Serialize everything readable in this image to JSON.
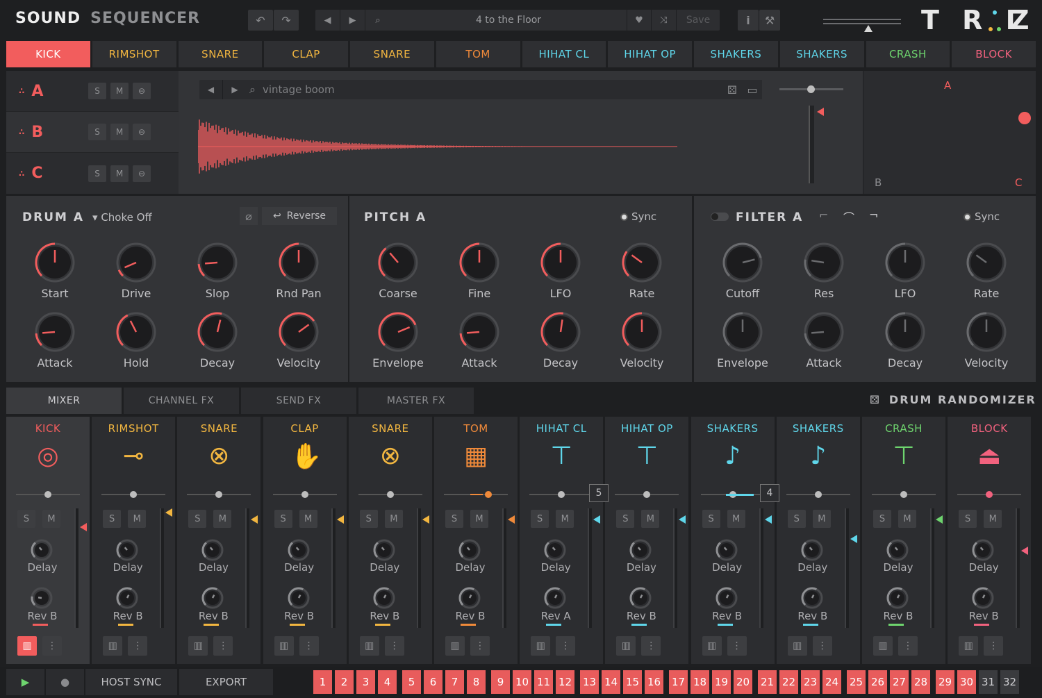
{
  "header": {
    "title_a": "SOUND",
    "title_b": "SEQUENCER",
    "preset_name": "4 to the Floor",
    "save_label": "Save",
    "logo": "TRIAZ"
  },
  "instruments": [
    {
      "label": "KICK",
      "color": "#f25d5d"
    },
    {
      "label": "RIMSHOT",
      "color": "#f2b640"
    },
    {
      "label": "SNARE",
      "color": "#f2b640"
    },
    {
      "label": "CLAP",
      "color": "#f2b640"
    },
    {
      "label": "SNARE",
      "color": "#f2b640"
    },
    {
      "label": "TOM",
      "color": "#f08a3a"
    },
    {
      "label": "HIHAT CL",
      "color": "#5fd6ea"
    },
    {
      "label": "HIHAT OP",
      "color": "#5fd6ea"
    },
    {
      "label": "SHAKERS",
      "color": "#5fd6ea"
    },
    {
      "label": "SHAKERS",
      "color": "#5fd6ea"
    },
    {
      "label": "CRASH",
      "color": "#6ed46e"
    },
    {
      "label": "BLOCK",
      "color": "#f2627e"
    }
  ],
  "layers": [
    {
      "letter": "A",
      "s": "S",
      "m": "M"
    },
    {
      "letter": "B",
      "s": "S",
      "m": "M"
    },
    {
      "letter": "C",
      "s": "S",
      "m": "M"
    }
  ],
  "sample": {
    "name": "vintage boom"
  },
  "xy": {
    "a": "A",
    "b": "B",
    "c": "C"
  },
  "drum": {
    "title": "DRUM A",
    "choke": "Choke Off",
    "reverse": "Reverse",
    "knobs": [
      {
        "label": "Start",
        "value": 0.5
      },
      {
        "label": "Drive",
        "value": 0.08
      },
      {
        "label": "Slop",
        "value": 0.15
      },
      {
        "label": "Rnd Pan",
        "value": 0.5
      },
      {
        "label": "Attack",
        "value": 0.15
      },
      {
        "label": "Hold",
        "value": 0.4
      },
      {
        "label": "Decay",
        "value": 0.55
      },
      {
        "label": "Velocity",
        "value": 0.7
      }
    ]
  },
  "pitch": {
    "title": "PITCH A",
    "sync": "Sync",
    "knobs": [
      {
        "label": "Coarse",
        "value": 0.35
      },
      {
        "label": "Fine",
        "value": 0.5
      },
      {
        "label": "LFO",
        "value": 0.5
      },
      {
        "label": "Rate",
        "value": 0.3
      },
      {
        "label": "Envelope",
        "value": 0.75
      },
      {
        "label": "Attack",
        "value": 0.15
      },
      {
        "label": "Decay",
        "value": 0.53
      },
      {
        "label": "Velocity",
        "value": 0.5
      }
    ]
  },
  "filter": {
    "title": "FILTER A",
    "sync": "Sync",
    "knobs": [
      {
        "label": "Cutoff",
        "value": 0.78
      },
      {
        "label": "Res",
        "value": 0.2
      },
      {
        "label": "LFO",
        "value": 0.5
      },
      {
        "label": "Rate",
        "value": 0.3
      },
      {
        "label": "Envelope",
        "value": 0.5
      },
      {
        "label": "Attack",
        "value": 0.15
      },
      {
        "label": "Decay",
        "value": 0.5
      },
      {
        "label": "Velocity",
        "value": 0.5
      }
    ]
  },
  "mixer_tabs": [
    "MIXER",
    "CHANNEL FX",
    "SEND FX",
    "MASTER FX"
  ],
  "randomizer": "DRUM RANDOMIZER",
  "mixer": {
    "delay_label": "Delay",
    "rev_labels": [
      "Rev B",
      "Rev B",
      "Rev B",
      "Rev B",
      "Rev B",
      "Rev B",
      "Rev A",
      "Rev B",
      "Rev B",
      "Rev B",
      "Rev B",
      "Rev B"
    ],
    "badge_hihat": "5",
    "badge_shakers": "4",
    "s": "S",
    "m": "M"
  },
  "transport": {
    "host_sync": "HOST SYNC",
    "export": "EXPORT"
  },
  "steps": [
    "1",
    "2",
    "3",
    "4",
    "5",
    "6",
    "7",
    "8",
    "9",
    "10",
    "11",
    "12",
    "13",
    "14",
    "15",
    "16",
    "17",
    "18",
    "19",
    "20",
    "21",
    "22",
    "23",
    "24",
    "25",
    "26",
    "27",
    "28",
    "29",
    "30",
    "31",
    "32"
  ],
  "active_steps": 30
}
